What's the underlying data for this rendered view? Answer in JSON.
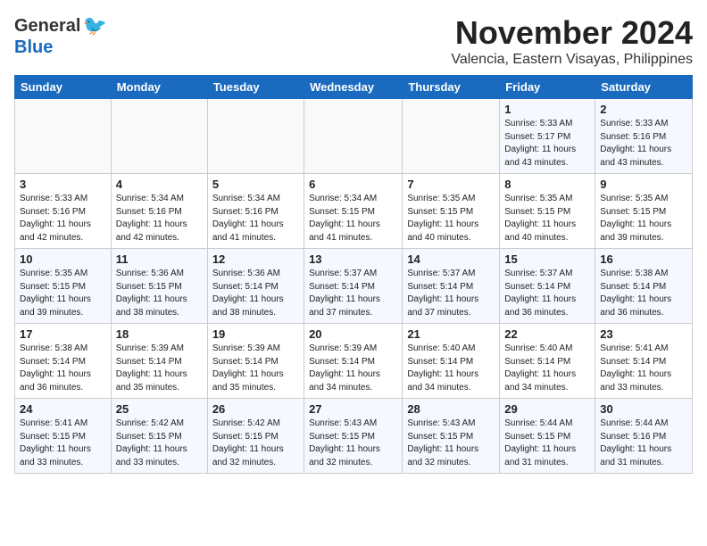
{
  "header": {
    "logo_general": "General",
    "logo_blue": "Blue",
    "title": "November 2024",
    "subtitle": "Valencia, Eastern Visayas, Philippines"
  },
  "weekdays": [
    "Sunday",
    "Monday",
    "Tuesday",
    "Wednesday",
    "Thursday",
    "Friday",
    "Saturday"
  ],
  "weeks": [
    [
      {
        "day": "",
        "detail": ""
      },
      {
        "day": "",
        "detail": ""
      },
      {
        "day": "",
        "detail": ""
      },
      {
        "day": "",
        "detail": ""
      },
      {
        "day": "",
        "detail": ""
      },
      {
        "day": "1",
        "detail": "Sunrise: 5:33 AM\nSunset: 5:17 PM\nDaylight: 11 hours and 43 minutes."
      },
      {
        "day": "2",
        "detail": "Sunrise: 5:33 AM\nSunset: 5:16 PM\nDaylight: 11 hours and 43 minutes."
      }
    ],
    [
      {
        "day": "3",
        "detail": "Sunrise: 5:33 AM\nSunset: 5:16 PM\nDaylight: 11 hours and 42 minutes."
      },
      {
        "day": "4",
        "detail": "Sunrise: 5:34 AM\nSunset: 5:16 PM\nDaylight: 11 hours and 42 minutes."
      },
      {
        "day": "5",
        "detail": "Sunrise: 5:34 AM\nSunset: 5:16 PM\nDaylight: 11 hours and 41 minutes."
      },
      {
        "day": "6",
        "detail": "Sunrise: 5:34 AM\nSunset: 5:15 PM\nDaylight: 11 hours and 41 minutes."
      },
      {
        "day": "7",
        "detail": "Sunrise: 5:35 AM\nSunset: 5:15 PM\nDaylight: 11 hours and 40 minutes."
      },
      {
        "day": "8",
        "detail": "Sunrise: 5:35 AM\nSunset: 5:15 PM\nDaylight: 11 hours and 40 minutes."
      },
      {
        "day": "9",
        "detail": "Sunrise: 5:35 AM\nSunset: 5:15 PM\nDaylight: 11 hours and 39 minutes."
      }
    ],
    [
      {
        "day": "10",
        "detail": "Sunrise: 5:35 AM\nSunset: 5:15 PM\nDaylight: 11 hours and 39 minutes."
      },
      {
        "day": "11",
        "detail": "Sunrise: 5:36 AM\nSunset: 5:15 PM\nDaylight: 11 hours and 38 minutes."
      },
      {
        "day": "12",
        "detail": "Sunrise: 5:36 AM\nSunset: 5:14 PM\nDaylight: 11 hours and 38 minutes."
      },
      {
        "day": "13",
        "detail": "Sunrise: 5:37 AM\nSunset: 5:14 PM\nDaylight: 11 hours and 37 minutes."
      },
      {
        "day": "14",
        "detail": "Sunrise: 5:37 AM\nSunset: 5:14 PM\nDaylight: 11 hours and 37 minutes."
      },
      {
        "day": "15",
        "detail": "Sunrise: 5:37 AM\nSunset: 5:14 PM\nDaylight: 11 hours and 36 minutes."
      },
      {
        "day": "16",
        "detail": "Sunrise: 5:38 AM\nSunset: 5:14 PM\nDaylight: 11 hours and 36 minutes."
      }
    ],
    [
      {
        "day": "17",
        "detail": "Sunrise: 5:38 AM\nSunset: 5:14 PM\nDaylight: 11 hours and 36 minutes."
      },
      {
        "day": "18",
        "detail": "Sunrise: 5:39 AM\nSunset: 5:14 PM\nDaylight: 11 hours and 35 minutes."
      },
      {
        "day": "19",
        "detail": "Sunrise: 5:39 AM\nSunset: 5:14 PM\nDaylight: 11 hours and 35 minutes."
      },
      {
        "day": "20",
        "detail": "Sunrise: 5:39 AM\nSunset: 5:14 PM\nDaylight: 11 hours and 34 minutes."
      },
      {
        "day": "21",
        "detail": "Sunrise: 5:40 AM\nSunset: 5:14 PM\nDaylight: 11 hours and 34 minutes."
      },
      {
        "day": "22",
        "detail": "Sunrise: 5:40 AM\nSunset: 5:14 PM\nDaylight: 11 hours and 34 minutes."
      },
      {
        "day": "23",
        "detail": "Sunrise: 5:41 AM\nSunset: 5:14 PM\nDaylight: 11 hours and 33 minutes."
      }
    ],
    [
      {
        "day": "24",
        "detail": "Sunrise: 5:41 AM\nSunset: 5:15 PM\nDaylight: 11 hours and 33 minutes."
      },
      {
        "day": "25",
        "detail": "Sunrise: 5:42 AM\nSunset: 5:15 PM\nDaylight: 11 hours and 33 minutes."
      },
      {
        "day": "26",
        "detail": "Sunrise: 5:42 AM\nSunset: 5:15 PM\nDaylight: 11 hours and 32 minutes."
      },
      {
        "day": "27",
        "detail": "Sunrise: 5:43 AM\nSunset: 5:15 PM\nDaylight: 11 hours and 32 minutes."
      },
      {
        "day": "28",
        "detail": "Sunrise: 5:43 AM\nSunset: 5:15 PM\nDaylight: 11 hours and 32 minutes."
      },
      {
        "day": "29",
        "detail": "Sunrise: 5:44 AM\nSunset: 5:15 PM\nDaylight: 11 hours and 31 minutes."
      },
      {
        "day": "30",
        "detail": "Sunrise: 5:44 AM\nSunset: 5:16 PM\nDaylight: 11 hours and 31 minutes."
      }
    ]
  ]
}
